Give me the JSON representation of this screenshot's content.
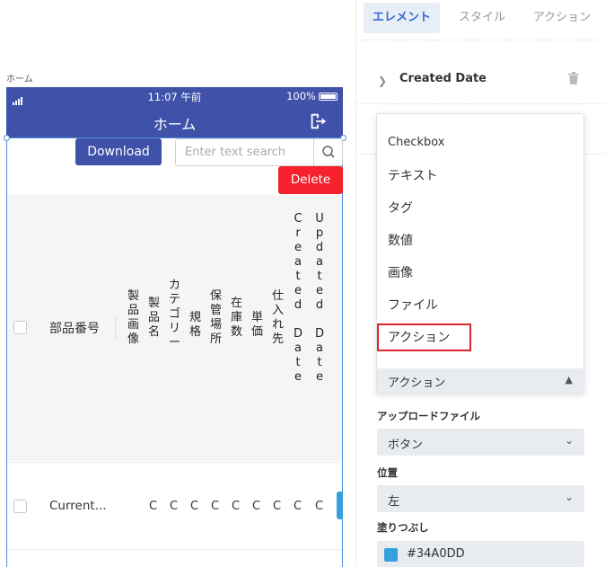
{
  "canvas": {
    "screen_label": "ホーム",
    "status": {
      "time": "11:07 午前",
      "battery": "100%"
    },
    "header_title": "ホーム",
    "download_label": "Download",
    "search_placeholder": "Enter text search",
    "delete_label": "Delete",
    "table": {
      "first_column": "部品番号",
      "vertical_columns": [
        "製品画像",
        "製品名",
        "カテゴリー",
        "規格",
        "保管場所",
        "在庫数",
        "単価",
        "仕入れ先",
        "Created Date",
        "Updated Date"
      ],
      "row_first_cell": "Current...",
      "row_cell_letter": "C"
    }
  },
  "panel": {
    "tabs": [
      {
        "label": "エレメント",
        "active": true
      },
      {
        "label": "スタイル",
        "active": false
      },
      {
        "label": "アクション",
        "active": false
      }
    ],
    "field_name": "Created Date",
    "dropdown_options": [
      "Checkbox",
      "テキスト",
      "タグ",
      "数値",
      "画像",
      "ファイル",
      "アクション"
    ],
    "dropdown_selected": "アクション",
    "upload_label": "アップロードファイル",
    "upload_value": "ボタン",
    "position_label": "位置",
    "position_value": "左",
    "fill_label": "塗りつぶし",
    "fill_value": "#34A0DD"
  },
  "colors": {
    "header": "#3f51a8",
    "delete": "#f5222d",
    "accent": "#34a0dd",
    "highlight_border": "#d9262c"
  },
  "icons": [
    "signal-icon",
    "battery-icon",
    "logout-icon",
    "search-icon",
    "chevron-right-icon",
    "trash-icon",
    "chevron-up-icon",
    "chevron-down-icon"
  ]
}
